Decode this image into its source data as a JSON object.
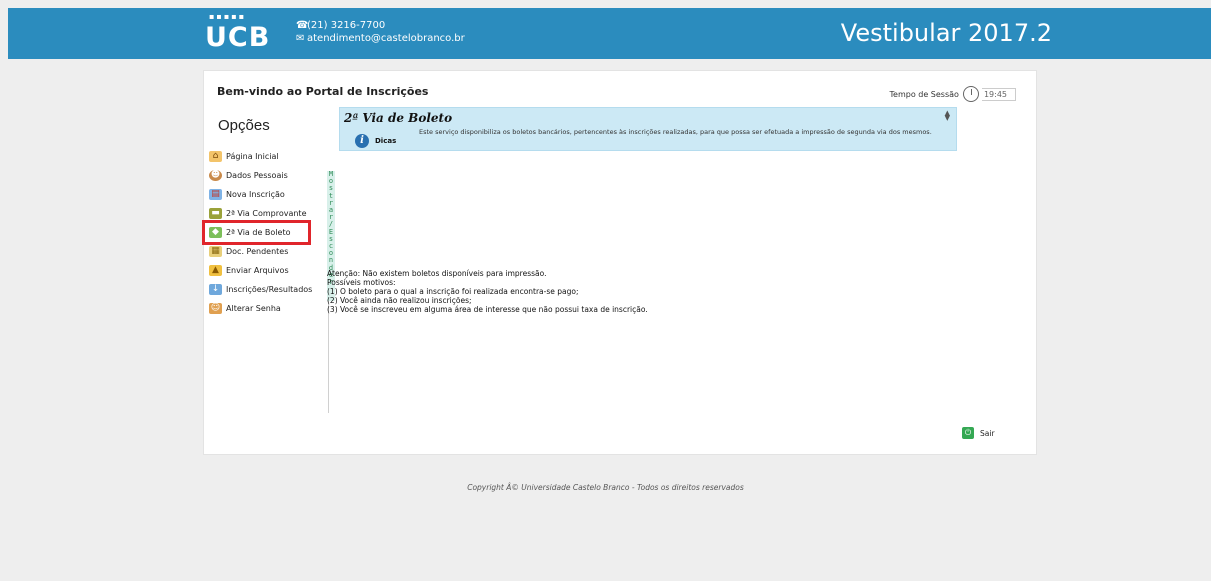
{
  "header": {
    "logo_dots": "▪▪▪▪▪",
    "logo_text": "UCB",
    "phone": "(21) 3216-7700",
    "email": "atendimento@castelobranco.br",
    "title": "Vestibular 2017.2",
    "bg_color": "#2b8cbe"
  },
  "card": {
    "welcome": "Bem-vindo ao Portal de Inscrições",
    "session_label": "Tempo de Sessão",
    "session_time": "19:45"
  },
  "sidebar": {
    "title": "Opções",
    "toggle_text": "Mostrar / Esconder",
    "items": [
      {
        "label": "Página Inicial",
        "icon": "home-icon"
      },
      {
        "label": "Dados Pessoais",
        "icon": "user-icon"
      },
      {
        "label": "Nova Inscrição",
        "icon": "form-icon"
      },
      {
        "label": "2ª Via Comprovante",
        "icon": "receipt-icon"
      },
      {
        "label": "2ª Via de Boleto",
        "icon": "money-icon"
      },
      {
        "label": "Doc. Pendentes",
        "icon": "documents-icon"
      },
      {
        "label": "Enviar Arquivos",
        "icon": "upload-icon"
      },
      {
        "label": "Inscrições/Resultados",
        "icon": "results-icon"
      },
      {
        "label": "Alterar Senha",
        "icon": "password-icon"
      }
    ],
    "active_index": 4,
    "highlight_color": "#e0252b"
  },
  "content": {
    "box_title": "2ª Via de Boleto",
    "dicas_label": "Dicas",
    "dicas_text": "Este serviço disponibiliza os boletos bancários, pertencentes às inscrições realizadas, para que possa ser efetuada a impressão de segunda via dos mesmos.",
    "notice_lines": [
      "Atenção: Não existem boletos disponíveis para impressão.",
      "Possíveis motivos:",
      "(1) O boleto para o qual a inscrição foi realizada encontra-se pago;",
      "(2) Você ainda não realizou inscrições;",
      "(3) Você se inscreveu em alguma área de interesse que não possui taxa de inscrição."
    ]
  },
  "footer": {
    "logout": "Sair",
    "copyright": "Copyright Â© Universidade Castelo Branco - Todos os direitos reservados"
  }
}
